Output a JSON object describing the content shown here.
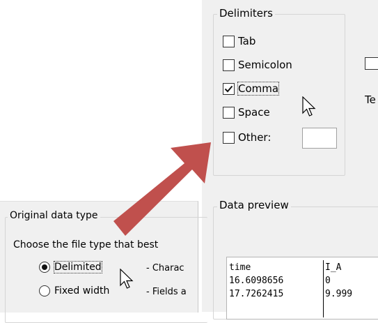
{
  "delimiters": {
    "legend": "Delimiters",
    "items": [
      {
        "label": "Tab",
        "checked": false
      },
      {
        "label": "Semicolon",
        "checked": false
      },
      {
        "label": "Comma",
        "checked": true
      },
      {
        "label": "Space",
        "checked": false
      },
      {
        "label": "Other:",
        "checked": false
      }
    ],
    "other_value": ""
  },
  "right_partial": {
    "text_fragment": "Te"
  },
  "data_preview": {
    "legend": "Data preview",
    "header": [
      "time",
      "I_A"
    ],
    "rows": [
      [
        "16.6098656",
        "0"
      ],
      [
        "17.7262415",
        "9.999"
      ]
    ]
  },
  "original_data_type": {
    "legend": "Original data type",
    "instruction": "Choose the file type that best",
    "options": [
      {
        "label": "Delimited",
        "selected": true,
        "description": "- Charac"
      },
      {
        "label": "Fixed width",
        "selected": false,
        "description": "- Fields a"
      }
    ]
  },
  "colors": {
    "arrow": "#c0504d",
    "panel": "#f0f0f0"
  }
}
